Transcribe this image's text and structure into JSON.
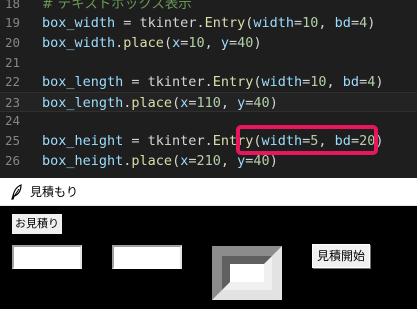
{
  "editor": {
    "lines": [
      {
        "num": "18",
        "tokens": [
          {
            "c": "comment",
            "t": "# テキストボックス表示"
          }
        ]
      },
      {
        "num": "19",
        "tokens": [
          {
            "c": "var",
            "t": "box_width"
          },
          {
            "c": "op",
            "t": " = "
          },
          {
            "c": "mod",
            "t": "tkinter."
          },
          {
            "c": "fn",
            "t": "Entry"
          },
          {
            "c": "op",
            "t": "("
          },
          {
            "c": "kw",
            "t": "width"
          },
          {
            "c": "op",
            "t": "="
          },
          {
            "c": "num",
            "t": "10"
          },
          {
            "c": "op",
            "t": ", "
          },
          {
            "c": "kw",
            "t": "bd"
          },
          {
            "c": "op",
            "t": "="
          },
          {
            "c": "num",
            "t": "4"
          },
          {
            "c": "op",
            "t": ")"
          }
        ]
      },
      {
        "num": "20",
        "tokens": [
          {
            "c": "var",
            "t": "box_width"
          },
          {
            "c": "op",
            "t": "."
          },
          {
            "c": "fn",
            "t": "place"
          },
          {
            "c": "op",
            "t": "("
          },
          {
            "c": "kw",
            "t": "x"
          },
          {
            "c": "op",
            "t": "="
          },
          {
            "c": "num",
            "t": "10"
          },
          {
            "c": "op",
            "t": ", "
          },
          {
            "c": "kw",
            "t": "y"
          },
          {
            "c": "op",
            "t": "="
          },
          {
            "c": "num",
            "t": "40"
          },
          {
            "c": "op",
            "t": ")"
          }
        ]
      },
      {
        "num": "21",
        "tokens": []
      },
      {
        "num": "22",
        "tokens": [
          {
            "c": "var",
            "t": "box_length"
          },
          {
            "c": "op",
            "t": " = "
          },
          {
            "c": "mod",
            "t": "tkinter."
          },
          {
            "c": "fn",
            "t": "Entry"
          },
          {
            "c": "op",
            "t": "("
          },
          {
            "c": "kw",
            "t": "width"
          },
          {
            "c": "op",
            "t": "="
          },
          {
            "c": "num",
            "t": "10"
          },
          {
            "c": "op",
            "t": ", "
          },
          {
            "c": "kw",
            "t": "bd"
          },
          {
            "c": "op",
            "t": "="
          },
          {
            "c": "num",
            "t": "4"
          },
          {
            "c": "op",
            "t": ")"
          }
        ]
      },
      {
        "num": "23",
        "tokens": [
          {
            "c": "var",
            "t": "box_length"
          },
          {
            "c": "op",
            "t": "."
          },
          {
            "c": "fn",
            "t": "place"
          },
          {
            "c": "op",
            "t": "("
          },
          {
            "c": "kw",
            "t": "x"
          },
          {
            "c": "op",
            "t": "="
          },
          {
            "c": "num",
            "t": "110"
          },
          {
            "c": "op",
            "t": ", "
          },
          {
            "c": "kw",
            "t": "y"
          },
          {
            "c": "op",
            "t": "="
          },
          {
            "c": "num",
            "t": "40"
          },
          {
            "c": "op",
            "t": ")"
          }
        ]
      },
      {
        "num": "24",
        "tokens": []
      },
      {
        "num": "25",
        "tokens": [
          {
            "c": "var",
            "t": "box_height"
          },
          {
            "c": "op",
            "t": " = "
          },
          {
            "c": "mod",
            "t": "tkinter."
          },
          {
            "c": "fn",
            "t": "Entry"
          },
          {
            "c": "op",
            "t": "("
          },
          {
            "c": "kw",
            "t": "width"
          },
          {
            "c": "op",
            "t": "="
          },
          {
            "c": "num",
            "t": "5"
          },
          {
            "c": "op",
            "t": ", "
          },
          {
            "c": "kw",
            "t": "bd"
          },
          {
            "c": "op",
            "t": "="
          },
          {
            "c": "num",
            "t": "20"
          },
          {
            "c": "op",
            "t": ")"
          }
        ]
      },
      {
        "num": "26",
        "tokens": [
          {
            "c": "var",
            "t": "box_height"
          },
          {
            "c": "op",
            "t": "."
          },
          {
            "c": "fn",
            "t": "place"
          },
          {
            "c": "op",
            "t": "("
          },
          {
            "c": "kw",
            "t": "x"
          },
          {
            "c": "op",
            "t": "="
          },
          {
            "c": "num",
            "t": "210"
          },
          {
            "c": "op",
            "t": ", "
          },
          {
            "c": "kw",
            "t": "y"
          },
          {
            "c": "op",
            "t": "="
          },
          {
            "c": "num",
            "t": "40"
          },
          {
            "c": "op",
            "t": ")"
          }
        ]
      }
    ],
    "highlight_color": "#e8175d"
  },
  "window": {
    "title": "見積もり",
    "icon": "feather-icon",
    "label": "お見積り",
    "button_label": "見積開始",
    "entries": [
      {
        "name": "box-width-entry",
        "value": ""
      },
      {
        "name": "box-length-entry",
        "value": ""
      },
      {
        "name": "box-height-entry",
        "value": ""
      }
    ]
  }
}
